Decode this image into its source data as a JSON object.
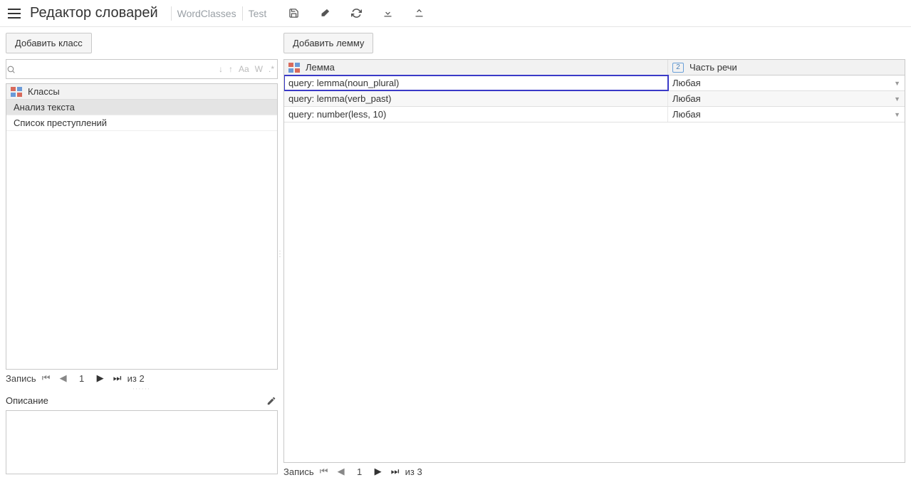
{
  "header": {
    "title": "Редактор словарей",
    "crumbs": [
      "WordClasses",
      "Test"
    ]
  },
  "left": {
    "add_button": "Добавить класс",
    "search_placeholder": "",
    "opts": {
      "down": "↓",
      "up": "↑",
      "aa": "Aa",
      "w": "W",
      "re": ".*"
    },
    "list_header": "Классы",
    "rows": [
      "Анализ текста",
      "Список преступлений"
    ],
    "selected_index": 0,
    "pager": {
      "label": "Запись",
      "cur": "1",
      "total": "из 2"
    },
    "description_label": "Описание"
  },
  "right": {
    "add_button": "Добавить лемму",
    "columns": {
      "lemma": "Лемма",
      "pos": "Часть речи"
    },
    "pos_badge": "2",
    "rows": [
      {
        "lemma": "query: lemma(noun_plural)",
        "pos": "Любая"
      },
      {
        "lemma": "query: lemma(verb_past)",
        "pos": "Любая"
      },
      {
        "lemma": "query: number(less, 10)",
        "pos": "Любая"
      }
    ],
    "selected_index": 0,
    "pager": {
      "label": "Запись",
      "cur": "1",
      "total": "из 3"
    }
  }
}
